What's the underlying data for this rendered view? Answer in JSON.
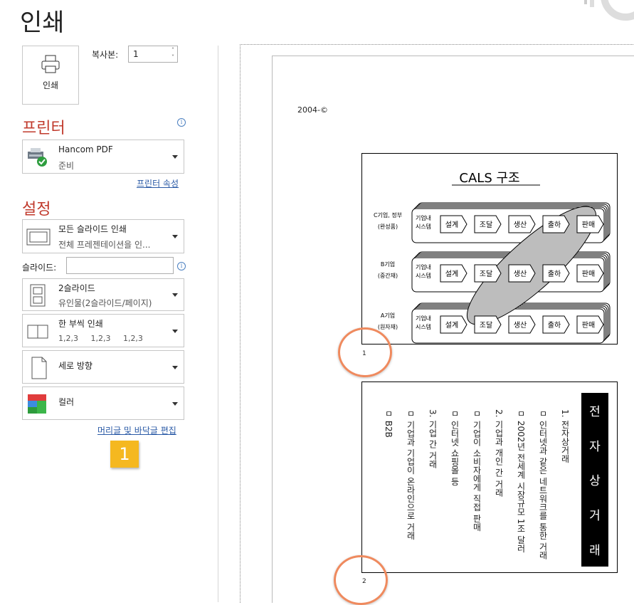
{
  "title": "인쇄",
  "print_button": {
    "label": "인쇄",
    "icon": "printer-icon"
  },
  "copies": {
    "label": "복사본:",
    "value": "1"
  },
  "printer": {
    "heading": "프린터",
    "name": "Hancom PDF",
    "status": "준비",
    "properties_link": "프린터 속성"
  },
  "settings": {
    "heading": "설정",
    "range": {
      "title": "모든 슬라이드 인쇄",
      "subtitle": "전체 프레젠테이션을 인..."
    },
    "slides_label": "슬라이드:",
    "slides_value": "",
    "layout": {
      "title": "2슬라이드",
      "subtitle": "유인물(2슬라이드/페이지)"
    },
    "collate": {
      "title": "한 부씩 인쇄",
      "subtitle": "1,2,3     1,2,3     1,2,3"
    },
    "orientation": {
      "title": "세로 방향"
    },
    "color": {
      "title": "컬러"
    },
    "header_footer_link": "머리글 및 바닥글 편집"
  },
  "callout_badge": "1",
  "preview": {
    "header_text": "2004-©",
    "slide1": {
      "number": "1",
      "title": "CALS 구조",
      "rows": [
        {
          "label1": "C기업, 정부",
          "label2": "(완성품)"
        },
        {
          "label1": "B기업",
          "label2": "(중간재)"
        },
        {
          "label1": "A기업",
          "label2": "(원자재)"
        }
      ],
      "system_label": [
        "기업내",
        "시스템"
      ],
      "stages": [
        "설계",
        "조달",
        "생산",
        "출하",
        "판매"
      ]
    },
    "slide2": {
      "number": "2",
      "title_chars": [
        "전",
        "자",
        "상",
        "거",
        "래"
      ],
      "columns": [
        "1. 전자상거래",
        "ㅁ 인터넷과 같은 네트워크를 통한 거래",
        "ㅁ 2002년 전세계 시장규모 1조 달러",
        "2. 기업과 개인 간 거래",
        "ㅁ 기업이 소비자에게 직접 판매",
        "ㅁ 인터넷 쇼핑몰 등",
        "3. 기업 간 거래",
        "ㅁ 기업과 기업이 온라인으로 거래",
        "ㅁ B2B"
      ]
    }
  },
  "colors": {
    "accent": "#c0392b",
    "link": "#2a5aa6",
    "callout": "#f5b820",
    "circle": "#ef8a5e"
  }
}
